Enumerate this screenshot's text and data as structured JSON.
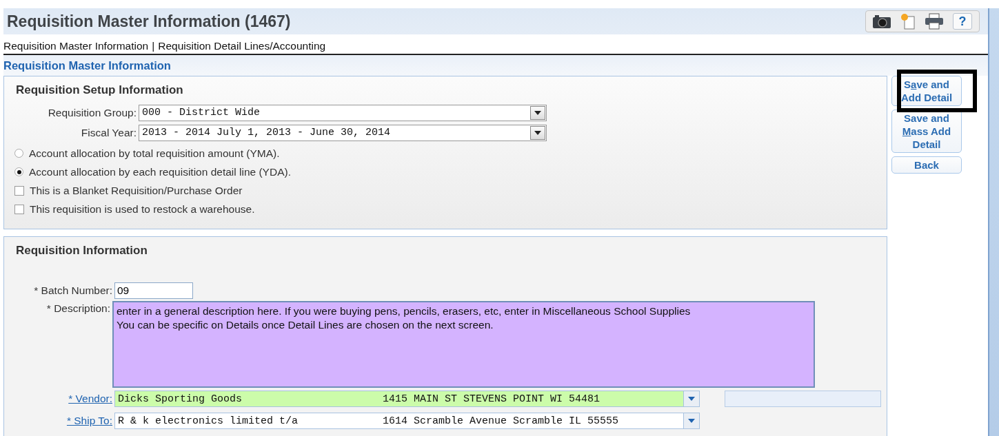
{
  "header": {
    "title": "Requisition Master Information (1467)",
    "toolbar": {
      "help": "?"
    }
  },
  "nav": {
    "links": [
      {
        "label": "Requisition Master Information"
      },
      {
        "label": "Requisition Detail Lines/Accounting"
      }
    ],
    "separator": "|"
  },
  "section_title": "Requisition Master Information",
  "setup": {
    "title": "Requisition Setup Information",
    "selects": [
      {
        "label": "Requisition Group:",
        "value": "000 - District Wide"
      },
      {
        "label": "Fiscal Year:",
        "value": "2013 - 2014 July 1, 2013 - June 30, 2014"
      }
    ],
    "options": [
      {
        "kind": "radio",
        "label": "Account allocation by total requisition amount (YMA).",
        "selected": false
      },
      {
        "kind": "radio",
        "label": "Account allocation by each requisition detail line (YDA).",
        "selected": true
      },
      {
        "kind": "checkbox",
        "label": "This is a Blanket Requisition/Purchase Order",
        "checked": false
      },
      {
        "kind": "checkbox",
        "label": "This requisition is used to restock a warehouse.",
        "checked": false
      }
    ]
  },
  "info": {
    "title": "Requisition Information",
    "batch": {
      "label": "* Batch Number:",
      "value": "09"
    },
    "description": {
      "label": "* Description:",
      "lines": [
        "enter in a general description here. If you were buying pens, pencils, erasers, etc, enter in Miscellaneous School Supplies",
        "You can be specific on Details once Detail Lines are chosen on the next screen."
      ]
    },
    "vendor": {
      "label": "* Vendor:",
      "name": "Dicks Sporting Goods",
      "address": "1415 MAIN ST STEVENS POINT WI 54481"
    },
    "ship_to": {
      "label": "* Ship To:",
      "name": "R & k electronics limited t/a",
      "address": "1614 Scramble Avenue Scramble IL 55555"
    }
  },
  "actions": [
    {
      "before": "S",
      "key": "a",
      "after": "ve and Add Detail",
      "highlighted": true
    },
    {
      "before": "Save and ",
      "key": "M",
      "after": "ass Add Detail",
      "highlighted": false
    },
    {
      "after": "Back",
      "highlighted": false
    }
  ]
}
